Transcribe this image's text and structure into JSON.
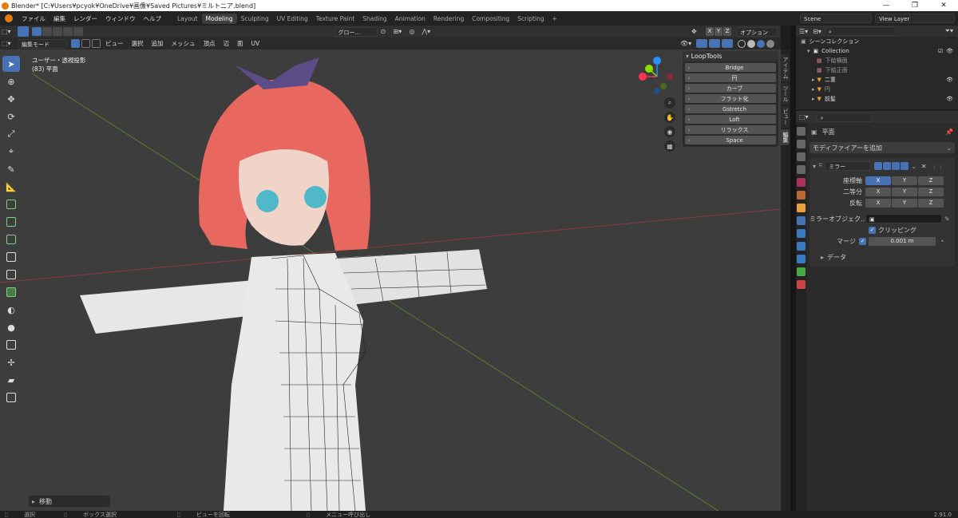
{
  "window": {
    "title": "Blender* [C:¥Users¥pcyok¥OneDrive¥画像¥Saved Pictures¥ミルトニア.blend]",
    "minimize": "—",
    "maximize": "❐",
    "close": "✕"
  },
  "menus": [
    "ファイル",
    "編集",
    "レンダー",
    "ウィンドウ",
    "ヘルプ"
  ],
  "workspaces": [
    "Layout",
    "Modeling",
    "Sculpting",
    "UV Editing",
    "Texture Paint",
    "Shading",
    "Animation",
    "Rendering",
    "Compositing",
    "Scripting",
    "+"
  ],
  "active_workspace": "Modeling",
  "scene": {
    "scene_name": "Scene",
    "view_layer": "View Layer"
  },
  "viewport_header": {
    "mode": "編集モード",
    "menus": [
      "ビュー",
      "選択",
      "追加",
      "メッシュ",
      "頂点",
      "辺",
      "面",
      "UV"
    ],
    "orientation": "グロー...",
    "axes": [
      "X",
      "Y",
      "Z"
    ],
    "options": "オプション"
  },
  "viewport": {
    "view_name": "ユーザー・透視投影",
    "object_info": "(83) 平面",
    "last_op": "移動"
  },
  "loop_tools": {
    "title": "LoopTools",
    "items": [
      "Bridge",
      "円",
      "カーブ",
      "フラット化",
      "Gstretch",
      "Loft",
      "リラックス",
      "Space"
    ]
  },
  "side_tabs": [
    "アイテム",
    "ツール",
    "ビュー",
    "編集"
  ],
  "outliner": {
    "title": "シーンコレクション",
    "collection": "Collection",
    "items": [
      {
        "name": "下絵横面"
      },
      {
        "name": "下絵正面"
      },
      {
        "name": "二重"
      },
      {
        "name": "円"
      },
      {
        "name": "前髪"
      }
    ]
  },
  "properties": {
    "object": "平面",
    "add_modifier": "モディファイアーを追加",
    "modifier_name": "ミラー",
    "axis_label": "座標軸",
    "bisect_label": "二等分",
    "flip_label": "反転",
    "xyz": [
      "X",
      "Y",
      "Z"
    ],
    "mirror_object_label": "ミラーオブジェク...",
    "clipping": "クリッピング",
    "merge_label": "マージ",
    "merge_value": "0.001 m",
    "data": "データ"
  },
  "status": {
    "select": "選択",
    "box_select": "ボックス選択",
    "rotate_view": "ビューを回転",
    "call_menu": "メニュー呼び出し",
    "version": "2.91.0"
  },
  "colors": {
    "accent": "#4772b3",
    "x_axis": "#ff3352",
    "y_axis": "#8bdc00",
    "z_axis": "#2890ff"
  }
}
